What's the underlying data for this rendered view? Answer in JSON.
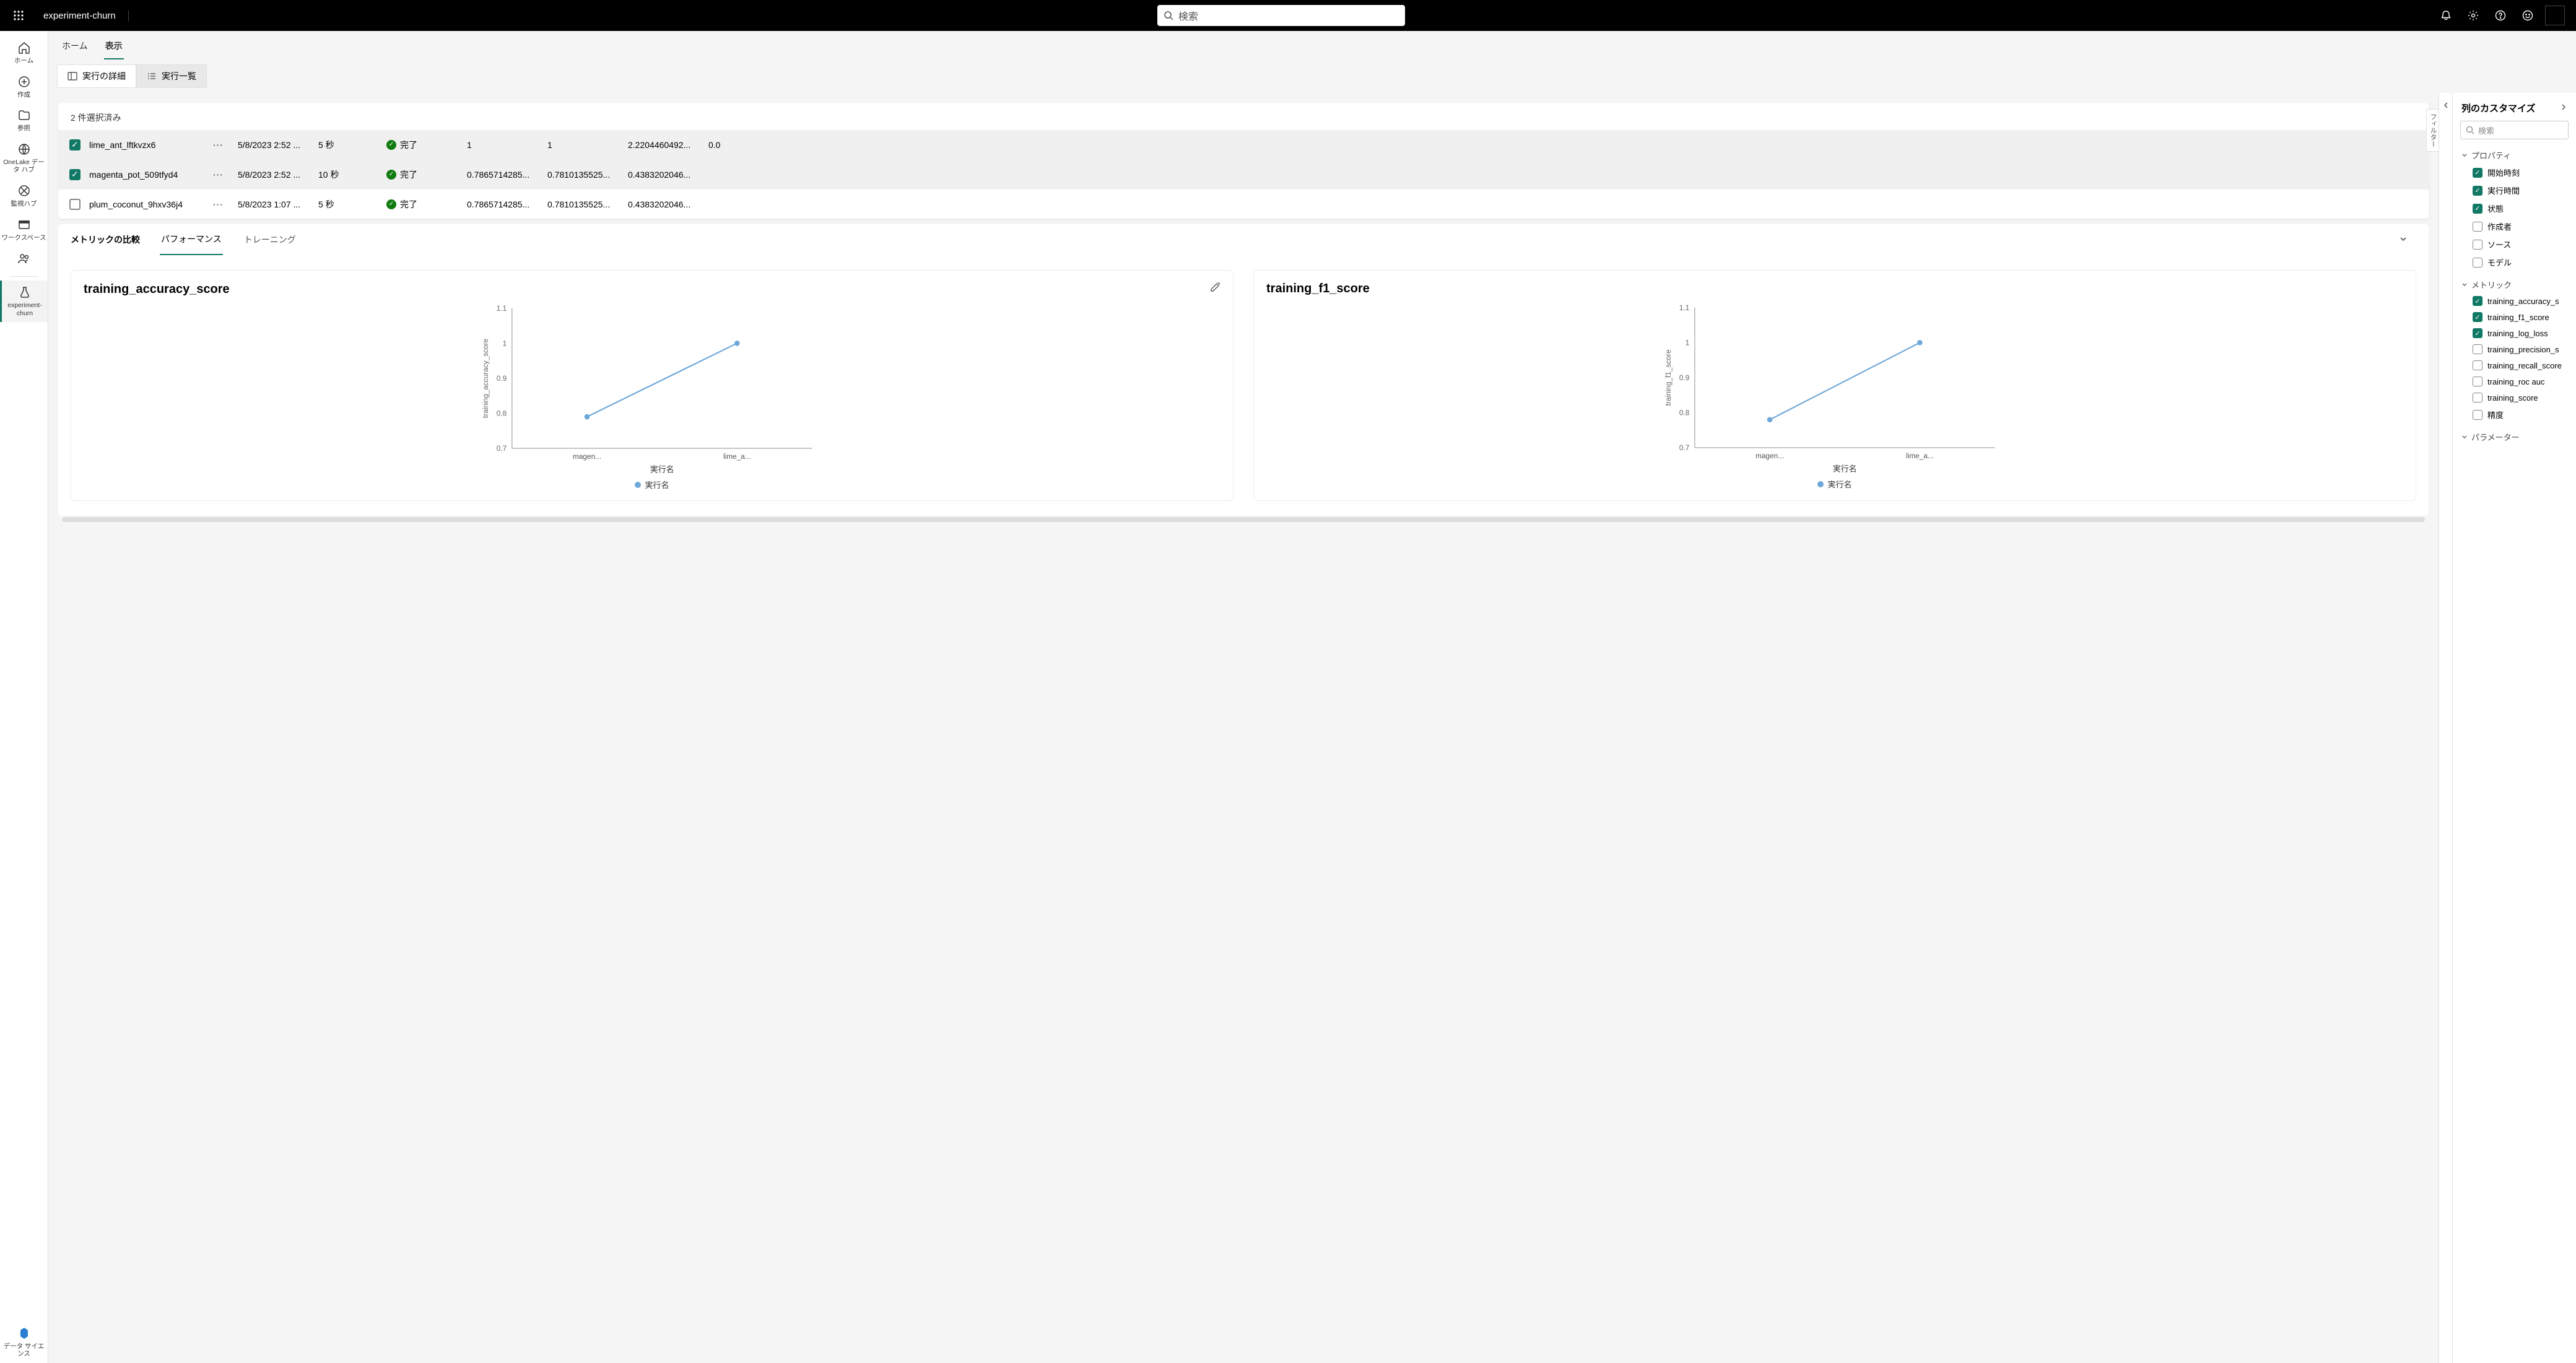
{
  "header": {
    "title": "experiment-churn",
    "search_placeholder": "検索"
  },
  "left_rail": {
    "home": "ホーム",
    "create": "作成",
    "browse": "参照",
    "onelake": "OneLake データ ハブ",
    "monitor": "監視ハブ",
    "workspace": "ワークスペース",
    "experiment": "experiment-churn",
    "data_science": "データ サイエンス"
  },
  "tabs1": {
    "home": "ホーム",
    "view": "表示"
  },
  "view_toggle": {
    "details": "実行の詳細",
    "list": "実行一覧"
  },
  "runs": {
    "selection_text": "2 件選択済み",
    "filter_label": "フィルター",
    "rows": [
      {
        "name": "lime_ant_lftkvzx6",
        "date": "5/8/2023 2:52 ...",
        "duration": "5 秒",
        "status": "完了",
        "m1": "1",
        "m2": "1",
        "m3": "2.2204460492...",
        "m4": "0.0",
        "checked": true
      },
      {
        "name": "magenta_pot_509tfyd4",
        "date": "5/8/2023 2:52 ...",
        "duration": "10 秒",
        "status": "完了",
        "m1": "0.7865714285...",
        "m2": "0.7810135525...",
        "m3": "0.4383202046...",
        "m4": "",
        "checked": true
      },
      {
        "name": "plum_coconut_9hxv36j4",
        "date": "5/8/2023 1:07 ...",
        "duration": "5 秒",
        "status": "完了",
        "m1": "0.7865714285...",
        "m2": "0.7810135525...",
        "m3": "0.4383202046...",
        "m4": "",
        "checked": false
      }
    ]
  },
  "compare": {
    "label": "メトリックの比較",
    "performance": "パフォーマンス",
    "training": "トレーニング"
  },
  "charts": {
    "accuracy": {
      "title": "training_accuracy_score",
      "xlabel": "実行名",
      "legend": "実行名"
    },
    "f1": {
      "title": "training_f1_score",
      "xlabel": "実行名",
      "legend": "実行名"
    },
    "xtick1": "magen...",
    "xtick2": "lime_a..."
  },
  "chart_data": [
    {
      "type": "line",
      "title": "training_accuracy_score",
      "categories": [
        "magen...",
        "lime_a..."
      ],
      "series": [
        {
          "name": "実行名",
          "values": [
            0.79,
            1.0
          ]
        }
      ],
      "ylabel": "training_accuracy_score",
      "xlabel": "実行名",
      "ylim": [
        0.7,
        1.1
      ],
      "yticks": [
        0.7,
        0.8,
        0.9,
        1,
        1.1
      ]
    },
    {
      "type": "line",
      "title": "training_f1_score",
      "categories": [
        "magen...",
        "lime_a..."
      ],
      "series": [
        {
          "name": "実行名",
          "values": [
            0.78,
            1.0
          ]
        }
      ],
      "ylabel": "training_f1_score",
      "xlabel": "実行名",
      "ylim": [
        0.7,
        1.1
      ],
      "yticks": [
        0.7,
        0.8,
        0.9,
        1,
        1.1
      ]
    }
  ],
  "customize": {
    "title": "列のカスタマイズ",
    "search_placeholder": "検索",
    "groups": {
      "properties": {
        "title": "プロパティ",
        "items": [
          {
            "label": "開始時刻",
            "checked": true
          },
          {
            "label": "実行時間",
            "checked": true
          },
          {
            "label": "状態",
            "checked": true
          },
          {
            "label": "作成者",
            "checked": false
          },
          {
            "label": "ソース",
            "checked": false
          },
          {
            "label": "モデル",
            "checked": false
          }
        ]
      },
      "metrics": {
        "title": "メトリック",
        "items": [
          {
            "label": "training_accuracy_s",
            "checked": true
          },
          {
            "label": "training_f1_score",
            "checked": true
          },
          {
            "label": "training_log_loss",
            "checked": true
          },
          {
            "label": "training_precision_s",
            "checked": false
          },
          {
            "label": "training_recall_score",
            "checked": false
          },
          {
            "label": "training_roc auc",
            "checked": false
          },
          {
            "label": "training_score",
            "checked": false
          },
          {
            "label": "精度",
            "checked": false
          }
        ]
      },
      "parameters": {
        "title": "パラメーター"
      }
    }
  }
}
